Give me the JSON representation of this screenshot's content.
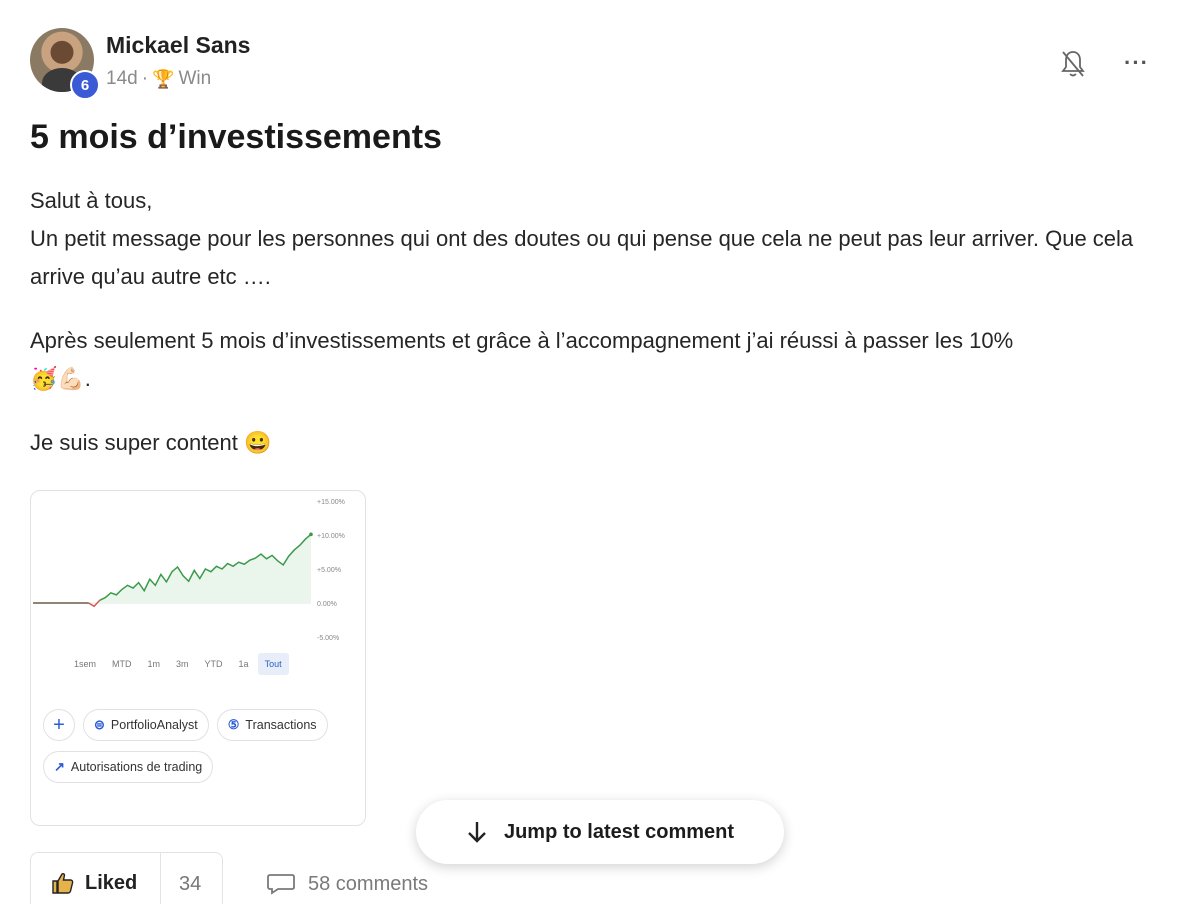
{
  "post": {
    "author": "Mickael Sans",
    "level": "6",
    "age": "14d",
    "separator": "·",
    "category": "Win",
    "title": "5 mois d’investissements",
    "body": {
      "line1": "Salut à tous,",
      "line2": "Un petit message pour les personnes qui ont des doutes ou qui pense que cela ne peut pas leur arriver. Que cela arrive qu’au autre etc ….",
      "line3": "Après seulement 5 mois d’investissements et grâce à l’accompagnement j’ai réussi à passer les 10%",
      "line3_emoji": "🥳💪🏻.",
      "line4": "Je suis super content 😀"
    }
  },
  "image": {
    "chart_data": {
      "type": "line",
      "y_ticks": [
        "+15.00%",
        "+10.00%",
        "+5.00%",
        "0.00%",
        "-5.00%"
      ],
      "ylim": [
        -5,
        15
      ],
      "x": [
        0,
        5,
        10,
        15,
        20,
        22,
        24,
        26,
        28,
        30,
        32,
        34,
        36,
        38,
        40,
        42,
        44,
        46,
        48,
        50,
        52,
        54,
        56,
        58,
        60,
        62,
        64,
        66,
        68,
        70,
        72,
        74,
        76,
        78,
        80,
        82,
        84,
        86,
        88,
        90,
        92,
        94,
        96,
        98,
        100
      ],
      "values": [
        0,
        0,
        0,
        0,
        0,
        -0.5,
        0.4,
        0.8,
        1.5,
        1.2,
        2.0,
        2.6,
        2.2,
        3.0,
        1.8,
        3.5,
        2.6,
        4.2,
        3.1,
        4.6,
        5.3,
        4.0,
        3.2,
        4.8,
        3.6,
        5.0,
        4.6,
        5.4,
        5.0,
        5.8,
        5.4,
        6.0,
        5.7,
        6.3,
        6.6,
        7.2,
        6.5,
        7.0,
        6.2,
        5.6,
        6.9,
        7.8,
        8.5,
        9.4,
        10.1
      ],
      "series_colors": {
        "line": "#3a9a4a",
        "negative": "#d9534f",
        "baseline": "#6b5a4a"
      }
    },
    "ranges": [
      "1sem",
      "MTD",
      "1m",
      "3m",
      "YTD",
      "1a",
      "Tout"
    ],
    "active_range": "Tout",
    "chips": {
      "plus": "+",
      "portfolio": "PortfolioAnalyst",
      "transactions": "Transactions",
      "trading": "Autorisations de trading"
    }
  },
  "actions": {
    "liked_label": "Liked",
    "like_count": "34",
    "comments_label": "58 comments",
    "jump_label": "Jump to latest comment"
  }
}
